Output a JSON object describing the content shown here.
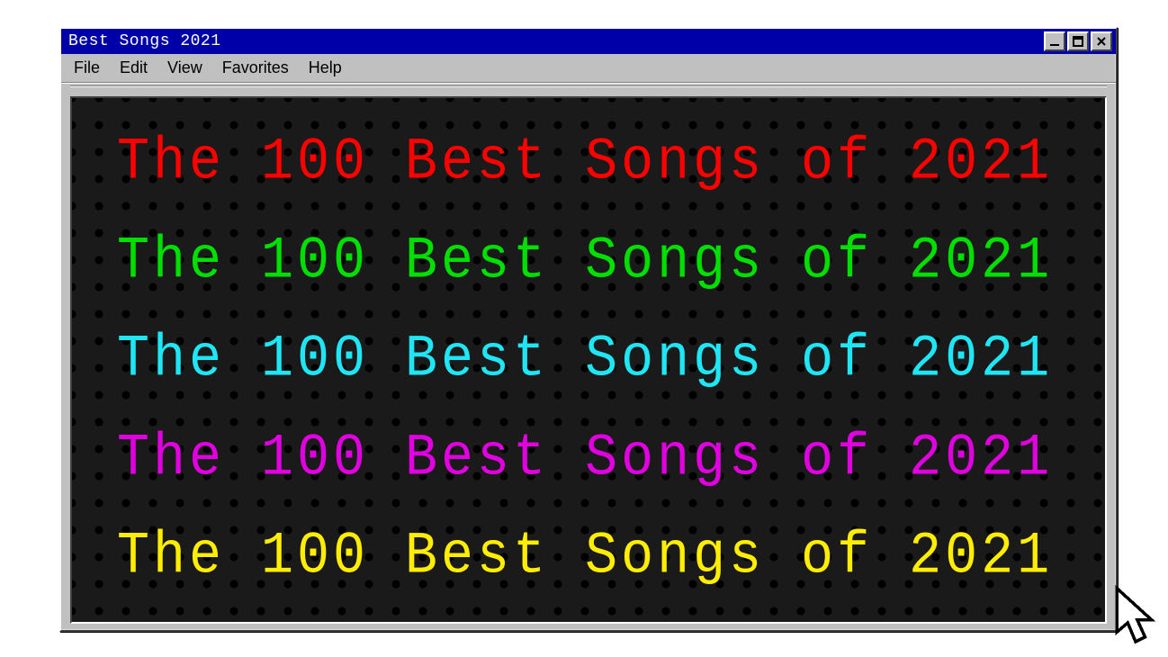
{
  "window": {
    "title": "Best Songs 2021"
  },
  "menubar": {
    "items": [
      {
        "label": "File"
      },
      {
        "label": "Edit"
      },
      {
        "label": "View"
      },
      {
        "label": "Favorites"
      },
      {
        "label": "Help"
      }
    ]
  },
  "content": {
    "headline": "The 100 Best Songs of 2021",
    "rows": [
      {
        "color": "red"
      },
      {
        "color": "green"
      },
      {
        "color": "cyan"
      },
      {
        "color": "magenta"
      },
      {
        "color": "yellow"
      }
    ]
  }
}
